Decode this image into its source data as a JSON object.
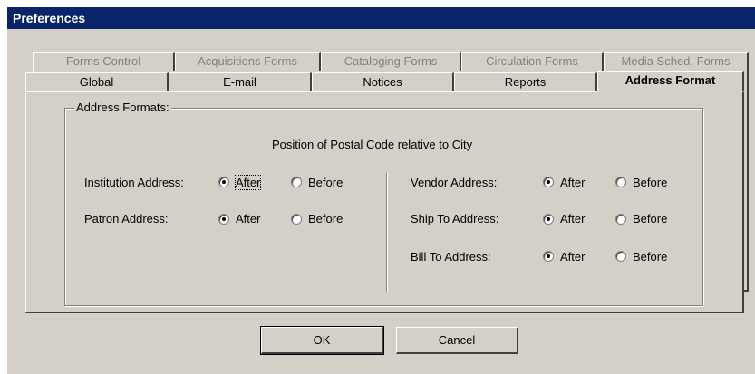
{
  "window": {
    "title": "Preferences"
  },
  "tabs_back": [
    {
      "label": "Forms Control",
      "mnemonic": "F"
    },
    {
      "label": "Acquisitions Forms",
      "mnemonic": "A"
    },
    {
      "label": "Cataloging Forms",
      "mnemonic": "t"
    },
    {
      "label": "Circulation Forms",
      "mnemonic": "i"
    },
    {
      "label": "Media Sched. Forms",
      "mnemonic": "M"
    }
  ],
  "tabs_front": [
    {
      "label": "Global",
      "mnemonic": "G"
    },
    {
      "label": "E-mail",
      "mnemonic": "E"
    },
    {
      "label": "Notices",
      "mnemonic": "N"
    },
    {
      "label": "Reports",
      "mnemonic": "R"
    },
    {
      "label": "Address Format",
      "mnemonic": "d",
      "active": true
    }
  ],
  "group": {
    "label": "Address Formats:",
    "subtitle": "Position of Postal Code relative to City"
  },
  "options": {
    "after": "After",
    "before": "Before"
  },
  "rows_left": [
    {
      "label": "Institution Address:",
      "selected": "After"
    },
    {
      "label": "Patron Address:",
      "selected": "After"
    }
  ],
  "rows_right": [
    {
      "label": "Vendor Address:",
      "selected": "After"
    },
    {
      "label": "Ship To Address:",
      "selected": "After"
    },
    {
      "label": "Bill To Address:",
      "selected": "After"
    }
  ],
  "buttons": {
    "ok": "OK",
    "cancel": "Cancel"
  }
}
